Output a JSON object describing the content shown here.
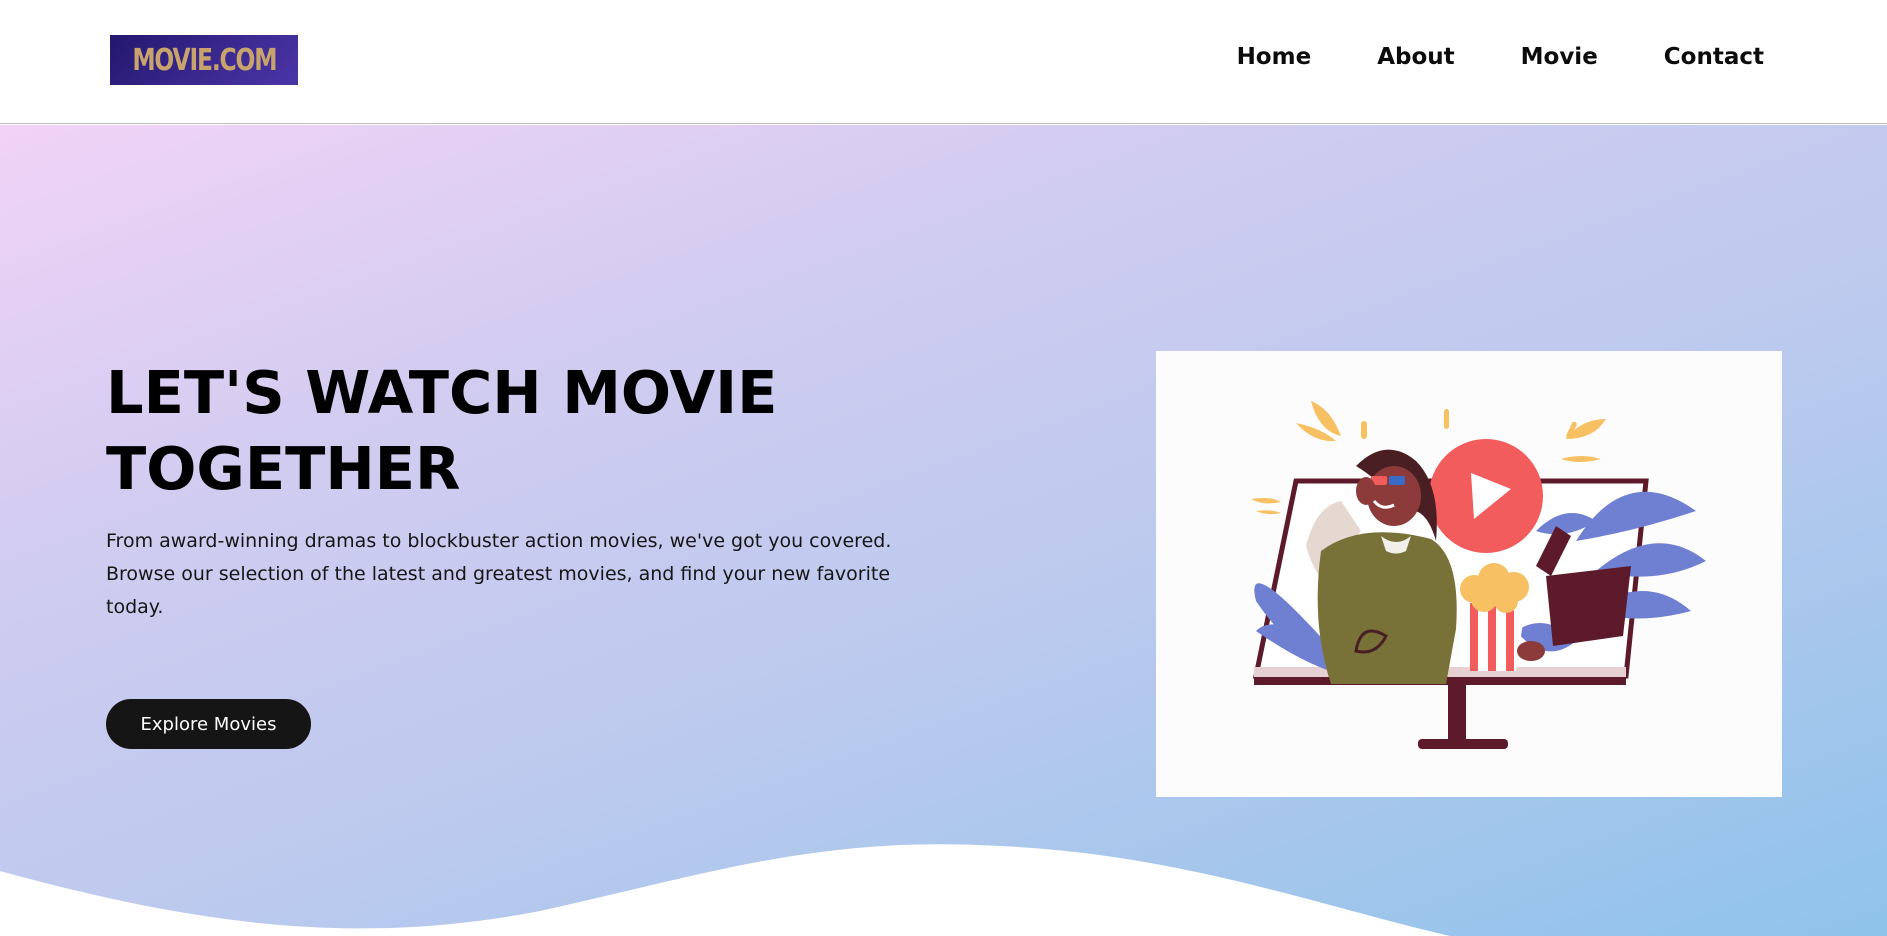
{
  "header": {
    "logo_text": "MOVIE.COM",
    "nav": [
      {
        "label": "Home"
      },
      {
        "label": "About"
      },
      {
        "label": "Movie"
      },
      {
        "label": "Contact"
      }
    ]
  },
  "hero": {
    "title_line1": "LET'S WATCH MOVIE",
    "title_line2": "TOGETHER",
    "description": "From award-winning dramas to blockbuster action movies, we've got you covered. Browse our selection of the latest and greatest movies, and find your new favorite today.",
    "cta_label": "Explore Movies",
    "illustration_icon": "woman-with-popcorn-in-monitor-illustration"
  },
  "colors": {
    "logo_bg": "#2d2080",
    "logo_text": "#c8a46c",
    "hero_gradient_start": "#f1d3f7",
    "hero_gradient_end": "#8fc3ea",
    "cta_bg": "#151515",
    "play_icon": "#f25c5c",
    "plant": "#6f80d3"
  }
}
